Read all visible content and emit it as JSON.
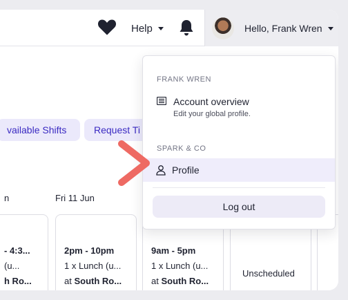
{
  "topbar": {
    "help_label": "Help",
    "user_label": "Hello, Frank Wren"
  },
  "actions": {
    "available_shifts": "vailable Shifts",
    "request_time": "Request Ti"
  },
  "schedule": {
    "days": [
      "n",
      "Fri 11 Jun"
    ],
    "shifts": [
      {
        "time": "- 4:3...",
        "role": "(u...",
        "location_prefix": "",
        "location": "h Ro..."
      },
      {
        "time": "2pm - 10pm",
        "role": "1 x Lunch (u...",
        "location_prefix": "at ",
        "location": "South Ro..."
      },
      {
        "time": "9am - 5pm",
        "role": "1 x Lunch (u...",
        "location_prefix": "at ",
        "location": "South Ro..."
      }
    ],
    "unscheduled_label": "Unscheduled"
  },
  "dropdown": {
    "user_section": "FRANK WREN",
    "account_overview": "Account overview",
    "account_overview_sub": "Edit your global profile.",
    "org_section": "SPARK & CO",
    "profile": "Profile",
    "logout": "Log out"
  },
  "colors": {
    "accent": "#3a2ac2",
    "chip_bg": "#ebe9fb",
    "annotation_arrow": "#ee6a63"
  },
  "icons": [
    "heart-icon",
    "bell-icon",
    "caret-down-icon",
    "list-icon",
    "user-icon",
    "arrow-annotation"
  ]
}
